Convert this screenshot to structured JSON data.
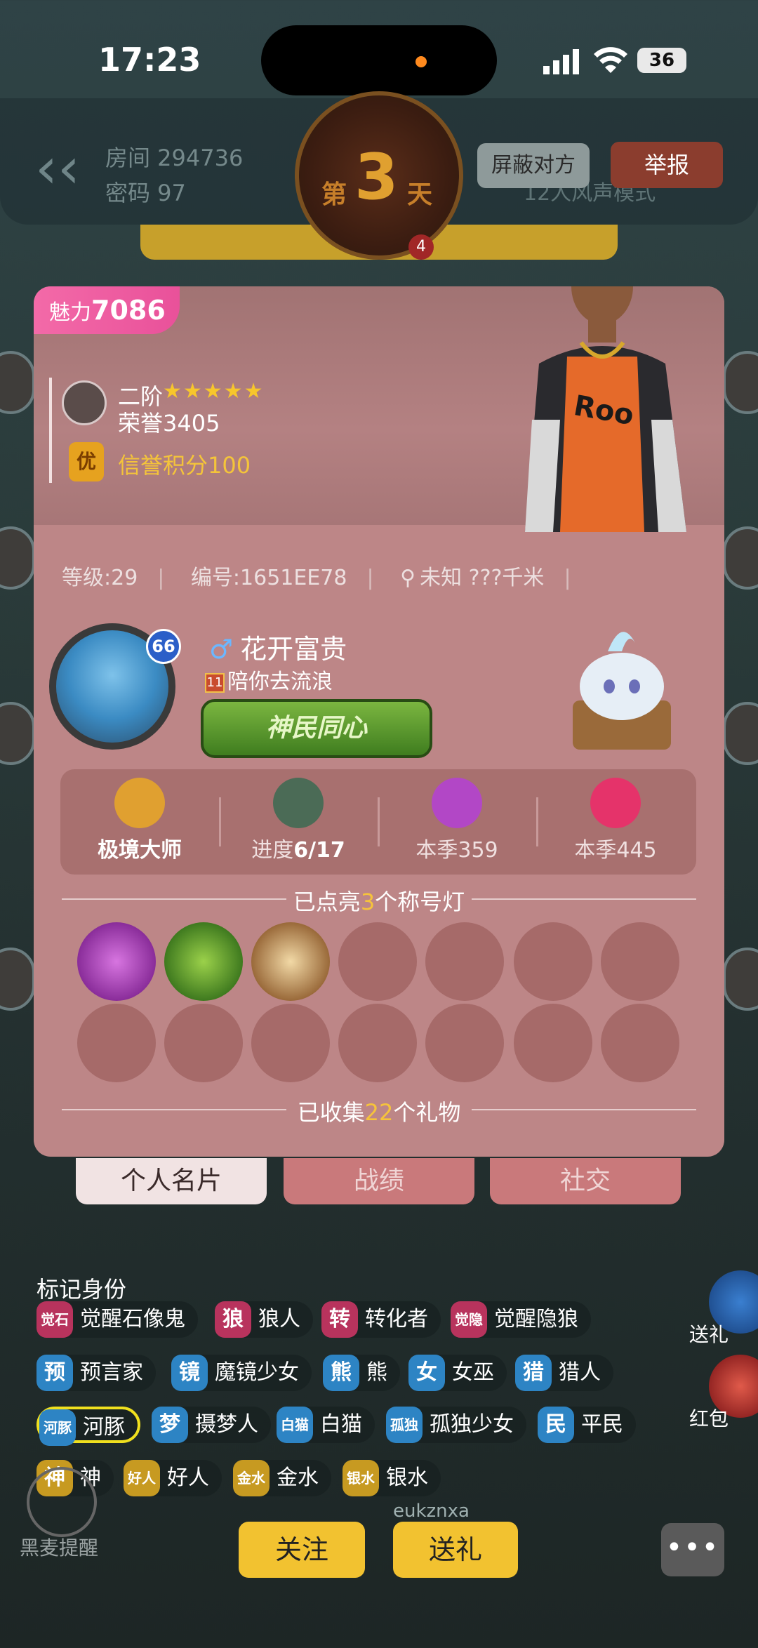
{
  "status_bar": {
    "time": "17:23",
    "battery": "36"
  },
  "room": {
    "room_label": "房间 294736",
    "password_label": "密码 97",
    "day_prefix": "第",
    "day_number": "3",
    "day_suffix": "天",
    "day_badge": "4",
    "block_button": "屏蔽对方",
    "report_button": "举报",
    "voice_info": "12人风声模式"
  },
  "profile": {
    "charm_label": "魅力",
    "charm_value": "7086",
    "rank_tier": "二阶",
    "rank_stars": "★★★★★",
    "honor": "荣誉3405",
    "credit_badge": "优",
    "credit": "信誉积分100",
    "level": "等级:29",
    "id": "编号:1651EE78",
    "location": "未知 ???千米",
    "avatar_level": "66",
    "gender_symbol": "♂",
    "name": "花开富贵",
    "tag_icon": "11",
    "tag": "陪你去流浪",
    "banner": "神民同心"
  },
  "stats": [
    {
      "label": "极境大师",
      "value": "",
      "icon_color": "#e0a030"
    },
    {
      "label": "进度",
      "value": "6/17",
      "icon_color": "#4b6b56"
    },
    {
      "label": "本季",
      "value": "359",
      "icon_color": "#b247c6"
    },
    {
      "label": "本季",
      "value": "445",
      "icon_color": "#e5336a"
    }
  ],
  "titles_section": {
    "prefix": "已点亮",
    "count": "3",
    "suffix": "个称号灯"
  },
  "gifts_section": {
    "prefix": "已收集",
    "count": "22",
    "suffix": "个礼物"
  },
  "tabs": [
    "个人名片",
    "战绩",
    "社交"
  ],
  "mark_identity": {
    "title": "标记身份",
    "rows": [
      [
        {
          "badge": "觉石",
          "label": "觉醒石像鬼",
          "color": "wolf",
          "small": true
        },
        {
          "badge": "狼",
          "label": "狼人",
          "color": "wolf",
          "small": false
        },
        {
          "badge": "转",
          "label": "转化者",
          "color": "wolf",
          "small": false
        },
        {
          "badge": "觉隐",
          "label": "觉醒隐狼",
          "color": "wolf",
          "small": true
        }
      ],
      [
        {
          "badge": "预",
          "label": "预言家",
          "color": "good",
          "small": false
        },
        {
          "badge": "镜",
          "label": "魔镜少女",
          "color": "good",
          "small": false
        },
        {
          "badge": "熊",
          "label": "熊",
          "color": "good",
          "small": false
        },
        {
          "badge": "女",
          "label": "女巫",
          "color": "good",
          "small": false
        },
        {
          "badge": "猎",
          "label": "猎人",
          "color": "good",
          "small": false
        }
      ],
      [
        {
          "badge": "河豚",
          "label": "河豚",
          "color": "good",
          "small": true,
          "selected": true
        },
        {
          "badge": "梦",
          "label": "摄梦人",
          "color": "good",
          "small": false
        },
        {
          "badge": "白猫",
          "label": "白猫",
          "color": "good",
          "small": true
        },
        {
          "badge": "孤独",
          "label": "孤独少女",
          "color": "good",
          "small": true
        },
        {
          "badge": "民",
          "label": "平民",
          "color": "good",
          "small": false
        }
      ],
      [
        {
          "badge": "神",
          "label": "神",
          "color": "neutral",
          "small": false
        },
        {
          "badge": "好人",
          "label": "好人",
          "color": "neutral",
          "small": true
        },
        {
          "badge": "金水",
          "label": "金水",
          "color": "neutral",
          "small": true
        },
        {
          "badge": "银水",
          "label": "银水",
          "color": "neutral",
          "small": true
        }
      ]
    ]
  },
  "side": {
    "gift_label": "送礼",
    "redpacket_label": "红包"
  },
  "bottom": {
    "follow_button": "关注",
    "gift_button": "送礼",
    "more_button": "•••",
    "mic_label": "黑麦提醒",
    "username": "eukznxa"
  }
}
